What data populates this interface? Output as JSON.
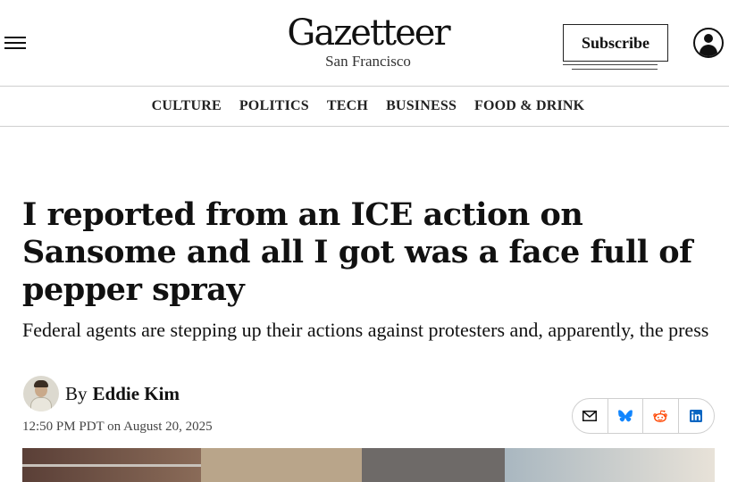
{
  "header": {
    "brand_name": "Gazetteer",
    "brand_city": "San Francisco",
    "subscribe_label": "Subscribe",
    "menu_icon": "hamburger-menu-icon",
    "account_icon": "user-account-icon"
  },
  "nav": {
    "items": [
      {
        "label": "CULTURE"
      },
      {
        "label": "POLITICS"
      },
      {
        "label": "TECH"
      },
      {
        "label": "BUSINESS"
      },
      {
        "label": "FOOD & DRINK"
      }
    ]
  },
  "article": {
    "headline": "I reported from an ICE action on Sansome and all I got was a face full of pepper spray",
    "dek": "Federal agents are stepping up their actions against protesters and, apparently, the press",
    "by_prefix": "By",
    "author": "Eddie Kim",
    "timestamp": "12:50 PM PDT on August 20, 2025",
    "share": [
      {
        "name": "email-share-icon"
      },
      {
        "name": "bluesky-share-icon"
      },
      {
        "name": "reddit-share-icon"
      },
      {
        "name": "linkedin-share-icon"
      }
    ]
  },
  "colors": {
    "text": "#111111",
    "divider": "#cfcfcf",
    "bluesky": "#1185fe",
    "reddit": "#ff4500",
    "linkedin": "#0a66c2"
  }
}
